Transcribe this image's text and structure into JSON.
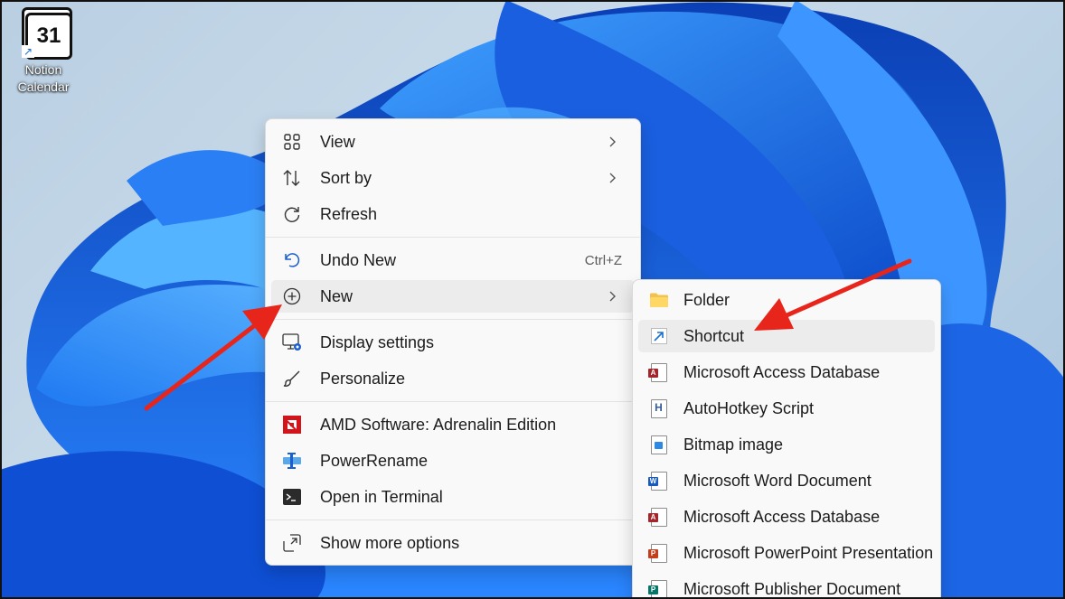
{
  "desktop": {
    "shortcut": {
      "tile_text": "31",
      "label_line1": "Notion",
      "label_line2": "Calendar"
    }
  },
  "context_menu": {
    "items": [
      {
        "label": "View",
        "icon": "grid-view-icon",
        "submenu": true
      },
      {
        "label": "Sort by",
        "icon": "sort-icon",
        "submenu": true
      },
      {
        "label": "Refresh",
        "icon": "refresh-icon"
      },
      {
        "label": "Undo New",
        "icon": "undo-icon",
        "shortcut": "Ctrl+Z"
      },
      {
        "label": "New",
        "icon": "plus-circle-icon",
        "submenu": true,
        "highlighted": true
      },
      {
        "label": "Display settings",
        "icon": "display-settings-icon"
      },
      {
        "label": "Personalize",
        "icon": "brush-icon"
      },
      {
        "label": "AMD Software: Adrenalin Edition",
        "icon": "amd-icon"
      },
      {
        "label": "PowerRename",
        "icon": "power-rename-icon"
      },
      {
        "label": "Open in Terminal",
        "icon": "terminal-icon"
      },
      {
        "label": "Show more options",
        "icon": "show-more-icon"
      }
    ]
  },
  "new_submenu": {
    "items": [
      {
        "label": "Folder",
        "icon": "folder-icon"
      },
      {
        "label": "Shortcut",
        "icon": "shortcut-icon",
        "highlighted": true
      },
      {
        "label": "Microsoft Access Database",
        "icon": "access-icon"
      },
      {
        "label": "AutoHotkey Script",
        "icon": "autohotkey-icon"
      },
      {
        "label": "Bitmap image",
        "icon": "bitmap-icon"
      },
      {
        "label": "Microsoft Word Document",
        "icon": "word-icon"
      },
      {
        "label": "Microsoft Access Database",
        "icon": "access-icon"
      },
      {
        "label": "Microsoft PowerPoint Presentation",
        "icon": "powerpoint-icon"
      },
      {
        "label": "Microsoft Publisher Document",
        "icon": "publisher-icon"
      }
    ]
  },
  "colors": {
    "menu_bg": "#f9f9f9",
    "highlight": "#ececec",
    "annotation_arrow": "#e8251b",
    "wallpaper_blue": "#1565e0"
  }
}
